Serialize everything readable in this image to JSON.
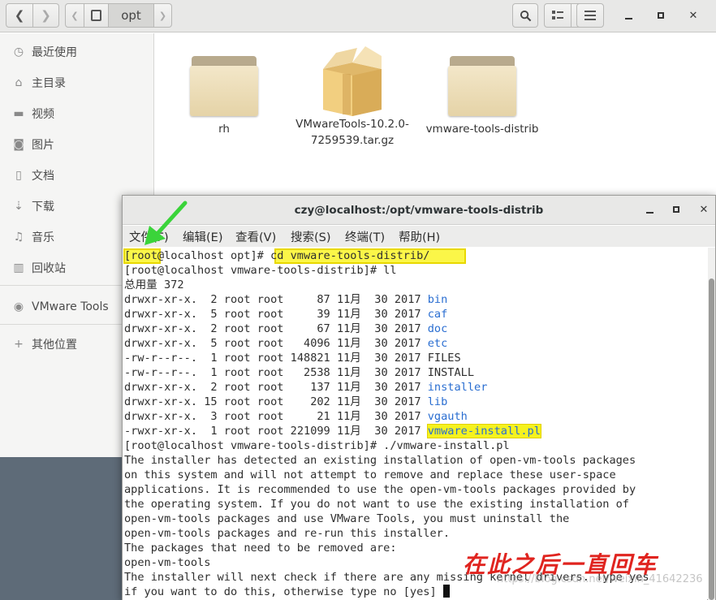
{
  "file_manager": {
    "header": {
      "back_icon": "chevron-left-icon",
      "forward_icon": "chevron-right-icon",
      "path_current": "opt",
      "search_icon": "search-icon",
      "view_icon": "list-view-icon",
      "menu_icon": "hamburger-menu-icon"
    },
    "window_controls": {
      "minimize": "—",
      "maximize": "□",
      "close": "✕"
    },
    "sidebar": {
      "items": [
        {
          "label": "最近使用",
          "icon": "clock-icon"
        },
        {
          "label": "主目录",
          "icon": "home-icon"
        },
        {
          "label": "视频",
          "icon": "video-icon"
        },
        {
          "label": "图片",
          "icon": "camera-icon"
        },
        {
          "label": "文档",
          "icon": "document-icon"
        },
        {
          "label": "下载",
          "icon": "download-icon"
        },
        {
          "label": "音乐",
          "icon": "music-icon"
        },
        {
          "label": "回收站",
          "icon": "trash-icon"
        },
        {
          "label": "VMware Tools",
          "icon": "disc-icon"
        },
        {
          "label": "其他位置",
          "icon": "plus-icon"
        }
      ]
    },
    "files": [
      {
        "name": "rh",
        "type": "folder"
      },
      {
        "name": "VMwareTools-10.2.0-\n7259539.tar.gz",
        "type": "archive"
      },
      {
        "name": "vmware-tools-distrib",
        "type": "folder"
      }
    ]
  },
  "terminal": {
    "title": "czy@localhost:/opt/vmware-tools-distrib",
    "menu": [
      "文件(F)",
      "编辑(E)",
      "查看(V)",
      "搜索(S)",
      "终端(T)",
      "帮助(H)"
    ],
    "lines": {
      "l1_prompt": "[root@localhost opt]#",
      "l1_cmd": " cd vmware-tools-distrib/",
      "l2": "[root@localhost vmware-tools-distrib]# ll",
      "l3": "总用量 372"
    },
    "listing": [
      {
        "perm": "drwxr-xr-x.",
        "links": " 2",
        "owner": "root root",
        "size": "    87",
        "date": "11月  30 2017",
        "name": "bin",
        "dir": true
      },
      {
        "perm": "drwxr-xr-x.",
        "links": " 5",
        "owner": "root root",
        "size": "    39",
        "date": "11月  30 2017",
        "name": "caf",
        "dir": true
      },
      {
        "perm": "drwxr-xr-x.",
        "links": " 2",
        "owner": "root root",
        "size": "    67",
        "date": "11月  30 2017",
        "name": "doc",
        "dir": true
      },
      {
        "perm": "drwxr-xr-x.",
        "links": " 5",
        "owner": "root root",
        "size": "  4096",
        "date": "11月  30 2017",
        "name": "etc",
        "dir": true
      },
      {
        "perm": "-rw-r--r--.",
        "links": " 1",
        "owner": "root root",
        "size": "148821",
        "date": "11月  30 2017",
        "name": "FILES",
        "dir": false
      },
      {
        "perm": "-rw-r--r--.",
        "links": " 1",
        "owner": "root root",
        "size": "  2538",
        "date": "11月  30 2017",
        "name": "INSTALL",
        "dir": false
      },
      {
        "perm": "drwxr-xr-x.",
        "links": " 2",
        "owner": "root root",
        "size": "   137",
        "date": "11月  30 2017",
        "name": "installer",
        "dir": true
      },
      {
        "perm": "drwxr-xr-x.",
        "links": "15",
        "owner": "root root",
        "size": "   202",
        "date": "11月  30 2017",
        "name": "lib",
        "dir": true
      },
      {
        "perm": "drwxr-xr-x.",
        "links": " 3",
        "owner": "root root",
        "size": "    21",
        "date": "11月  30 2017",
        "name": "vgauth",
        "dir": true
      },
      {
        "perm": "-rwxr-xr-x.",
        "links": " 1",
        "owner": "root root",
        "size": "221099",
        "date": "11月  30 2017",
        "name": "vmware-install.pl",
        "dir": false,
        "exec": true
      }
    ],
    "after": [
      "[root@localhost vmware-tools-distrib]# ./vmware-install.pl",
      "The installer has detected an existing installation of open-vm-tools packages",
      "on this system and will not attempt to remove and replace these user-space",
      "applications. It is recommended to use the open-vm-tools packages provided by",
      "the operating system. If you do not want to use the existing installation of",
      "open-vm-tools packages and use VMware Tools, you must uninstall the",
      "open-vm-tools packages and re-run this installer.",
      "The packages that need to be removed are:",
      "open-vm-tools",
      "The installer will next check if there are any missing kernel drivers. Type yes",
      "if you want to do this, otherwise type no [yes] "
    ]
  },
  "annotation": "在此之后一直回车",
  "watermark": "https://blog.csdn.net/weixin_41642236",
  "colors": {
    "highlight": "#f5f21e",
    "dir_blue": "#2a6ed1",
    "annotation_red": "#e0241f",
    "arrow_green": "#3ad43a"
  }
}
